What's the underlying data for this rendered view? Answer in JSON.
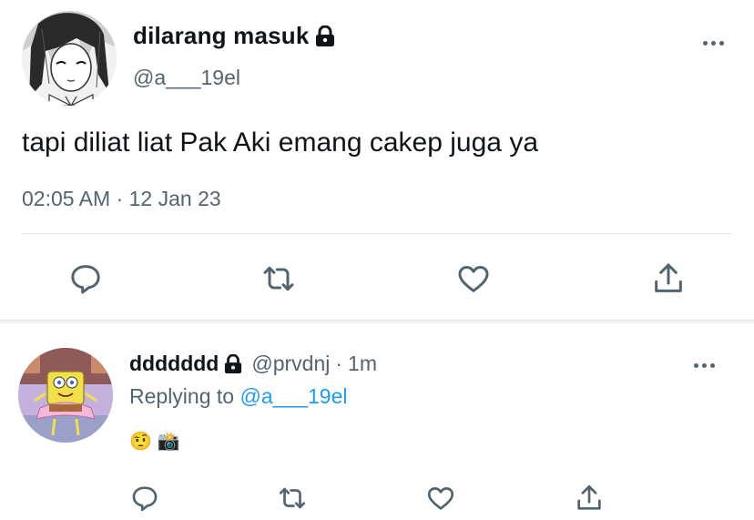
{
  "main_tweet": {
    "display_name": "dilarang masuk",
    "handle": "@a___19el",
    "text": "tapi diliat liat Pak Aki emang cakep juga ya",
    "time": "02:05 AM",
    "separator": "·",
    "date": "12 Jan 23",
    "avatar_icon": "anime-girl-manga-avatar",
    "actions": [
      "reply-icon",
      "retweet-icon",
      "like-icon",
      "share-icon"
    ]
  },
  "reply_tweet": {
    "display_name": "ddddddd",
    "handle": "@prvdnj",
    "separator": "·",
    "age": "1m",
    "replying_prefix": "Replying to",
    "replying_handle": "@a___19el",
    "emojis": [
      "🤨",
      "📸"
    ],
    "avatar_icon": "spongebob-avatar",
    "actions": [
      "reply-icon",
      "retweet-icon",
      "like-icon",
      "share-icon"
    ]
  },
  "colors": {
    "text": "#0f1419",
    "secondary": "#536471",
    "link": "#1d9bf0",
    "divider": "#e6e6e6",
    "separator_band": "#f2f2f2"
  }
}
